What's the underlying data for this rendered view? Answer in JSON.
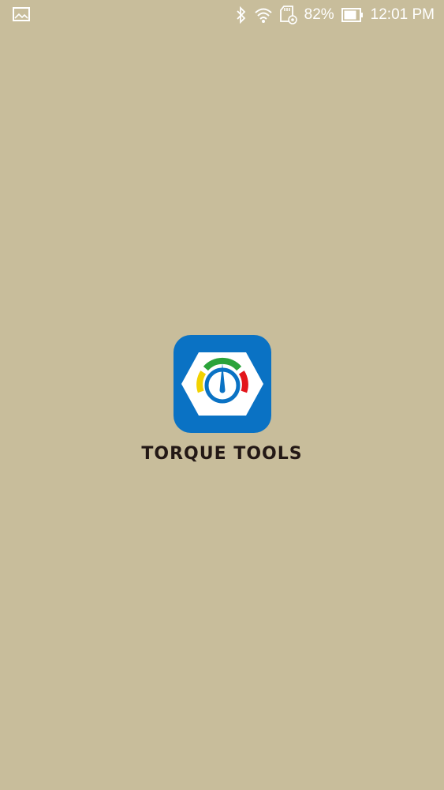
{
  "status_bar": {
    "battery_percent": "82%",
    "time": "12:01 PM",
    "icons": [
      "image-notification-icon",
      "bluetooth-icon",
      "wifi-icon",
      "sd-card-icon",
      "battery-icon"
    ]
  },
  "splash": {
    "app_name": "TORQUE TOOLS",
    "logo_icon": "torque-gauge-icon"
  },
  "colors": {
    "background": "#c8bd9b",
    "logo_blue": "#0a72c4",
    "gauge_green": "#2aa33a",
    "gauge_yellow": "#f2d200",
    "gauge_red": "#e3151b",
    "brand_text": "#231815"
  }
}
